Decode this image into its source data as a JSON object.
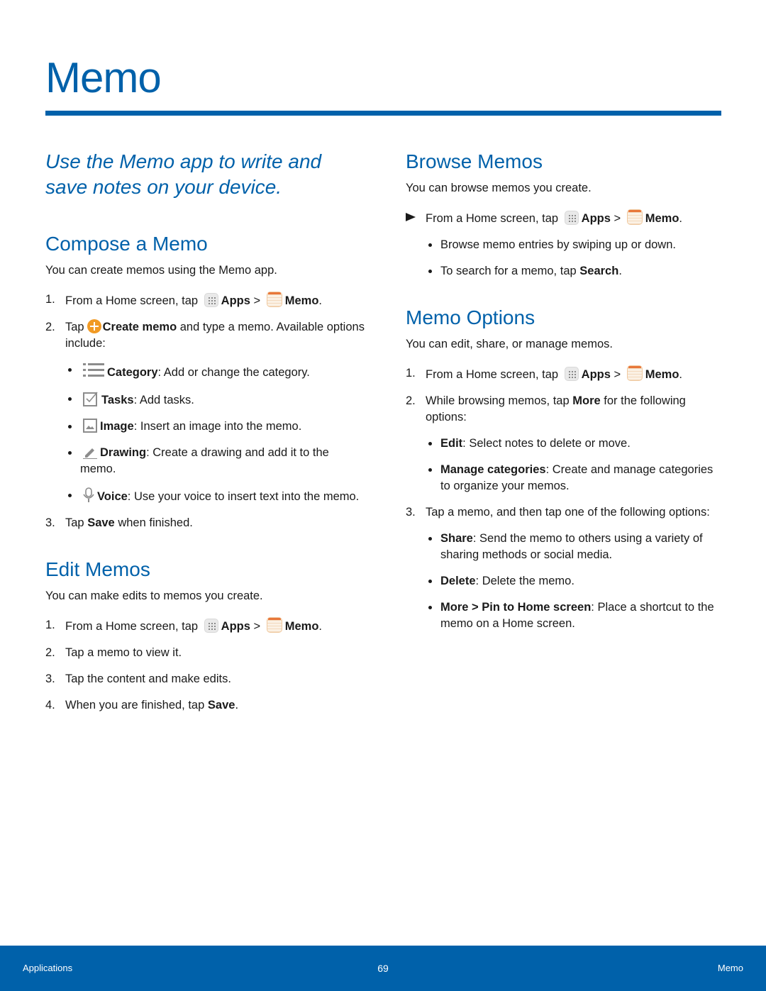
{
  "page": {
    "title": "Memo",
    "intro": "Use the Memo app to write and save notes on your device.",
    "accent_color": "#0061aa"
  },
  "compose": {
    "heading": "Compose a Memo",
    "lead": "You can create memos using the Memo app.",
    "step1": {
      "num": "1.",
      "pre": "From a Home screen, tap",
      "apps": "Apps",
      "sep": ">",
      "memo": "Memo",
      "end": "."
    },
    "step2": {
      "num": "2.",
      "pre": "Tap",
      "bold": "Create memo",
      "post": "and type a memo. Available options include:"
    },
    "options": [
      {
        "icon": "category-icon",
        "label": "Category",
        "desc": ": Add or change the category."
      },
      {
        "icon": "tasks-icon",
        "label": "Tasks",
        "desc": ": Add tasks."
      },
      {
        "icon": "image-icon",
        "label": "Image",
        "desc": ": Insert an image into the memo."
      },
      {
        "icon": "drawing-icon",
        "label": "Drawing",
        "desc": ": Create a drawing and add it to the memo."
      },
      {
        "icon": "voice-icon",
        "label": "Voice",
        "desc": ": Use your voice to insert text into the memo."
      }
    ],
    "step3": {
      "num": "3.",
      "pre": "Tap",
      "bold": "Save",
      "post": "when finished."
    }
  },
  "edit": {
    "heading": "Edit Memos",
    "lead": "You can make edits to memos you create.",
    "step1": {
      "num": "1.",
      "pre": "From a Home screen, tap",
      "apps": "Apps",
      "sep": ">",
      "memo": "Memo",
      "end": "."
    },
    "step2": {
      "num": "2.",
      "text": "Tap a memo to view it."
    },
    "step3": {
      "num": "3.",
      "text": "Tap the content and make edits."
    },
    "step4": {
      "num": "4.",
      "pre": "When you are finished, tap",
      "bold": "Save",
      "end": "."
    }
  },
  "browse": {
    "heading": "Browse Memos",
    "lead": "You can browse memos you create.",
    "step": {
      "pre": "From a Home screen, tap",
      "apps": "Apps",
      "sep": ">",
      "memo": "Memo",
      "end": "."
    },
    "bullet1": "Browse memo entries by swiping up or down.",
    "bullet2": {
      "pre": "To search for a memo, tap",
      "bold": "Search",
      "end": "."
    }
  },
  "options": {
    "heading": "Memo Options",
    "lead": "You can edit, share, or manage memos.",
    "step1": {
      "num": "1.",
      "pre": "From a Home screen, tap",
      "apps": "Apps",
      "sep": ">",
      "memo": "Memo",
      "end": "."
    },
    "step2": {
      "num": "2.",
      "pre": "While browsing memos, tap",
      "bold": "More",
      "post": "for the following options:"
    },
    "more_items": [
      {
        "label": "Edit",
        "desc": ": Select notes to delete or move."
      },
      {
        "label": "Manage categories",
        "desc": ": Create and manage categories to organize your memos."
      }
    ],
    "step3": {
      "num": "3.",
      "text": "Tap a memo, and then tap one of the following options:"
    },
    "memo_items": [
      {
        "label": "Share",
        "desc": ": Send the memo to others using a variety of sharing methods or social media."
      },
      {
        "label": "Delete",
        "desc": ": Delete the memo."
      },
      {
        "label": "More > Pin to Home screen",
        "desc": ": Place a shortcut to the memo on a Home screen."
      }
    ]
  },
  "footer": {
    "left": "Applications",
    "page_number": "69",
    "right": "Memo"
  }
}
